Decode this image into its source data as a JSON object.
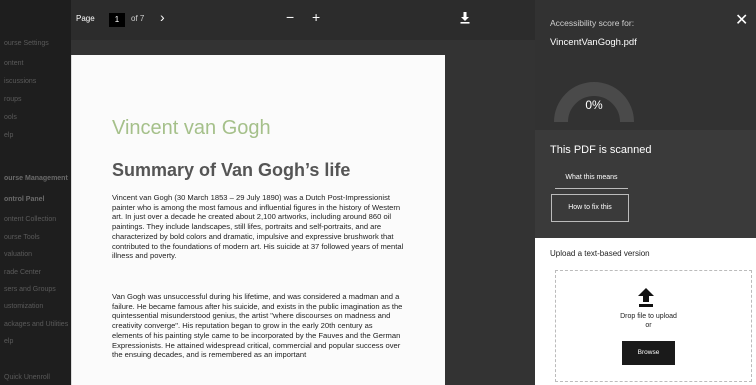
{
  "sidebar": {
    "items": [
      {
        "label": "ourse Settings",
        "head": false
      },
      {
        "label": "ontent",
        "head": false
      },
      {
        "label": "iscussions",
        "head": false
      },
      {
        "label": "roups",
        "head": false
      },
      {
        "label": "ools",
        "head": false
      },
      {
        "label": "elp",
        "head": false
      },
      {
        "label": "ourse Management",
        "head": true
      },
      {
        "label": "ontrol Panel",
        "head": true
      },
      {
        "label": "ontent Collection",
        "head": false
      },
      {
        "label": "ourse Tools",
        "head": false
      },
      {
        "label": "valuation",
        "head": false
      },
      {
        "label": "rade Center",
        "head": false
      },
      {
        "label": "sers and Groups",
        "head": false
      },
      {
        "label": "ustomization",
        "head": false
      },
      {
        "label": "ackages and Utilities",
        "head": false
      },
      {
        "label": "elp",
        "head": false
      },
      {
        "label": "Quick Unenroll",
        "head": false
      }
    ]
  },
  "toolbar": {
    "prev_icon": "‹",
    "next_icon": "›",
    "page_label": "Page",
    "page_value": "1",
    "page_of": "of 7",
    "zoom_out": "−",
    "zoom_in": "+",
    "download_icon": "download-icon"
  },
  "document": {
    "title": "Vincent van Gogh",
    "heading": "Summary of Van Gogh’s life",
    "paragraphs": [
      "Vincent van Gogh (30 March 1853 – 29 July 1890) was a Dutch Post-Impressionist painter who is among the most famous and influential figures in the history of Western art. In just over a decade he created about 2,100 artworks, including around 860 oil paintings. They include landscapes, still lifes, portraits and self-portraits, and are characterized by bold colors and dramatic, impulsive and expressive brushwork that contributed to the foundations of modern art. His suicide at 37 followed years of mental illness and poverty.",
      "Van Gogh was unsuccessful during his lifetime, and was considered a madman and a failure. He became famous after his suicide, and exists in the public imagination as the quintessential misunderstood genius, the artist \"where discourses on madness and creativity converge\". His reputation began to grow in the early 20th century as elements of his painting style came to be incorporated by the Fauves and the German Expressionists. He attained widespread critical, commercial and popular success over the ensuing decades, and is remembered as an important"
    ]
  },
  "panel": {
    "score_label": "Accessibility score for:",
    "filename": "VincentVanGogh.pdf",
    "close_icon": "✕",
    "score_percent": "0%",
    "score_value": 0,
    "scan_message": "This PDF is scanned",
    "what_button": "What this means",
    "fix_button": "How to fix this",
    "upload_title": "Upload a text-based version",
    "drop_text": "Drop file to upload",
    "drop_or": "or",
    "browse_button": "Browse"
  },
  "colors": {
    "title_green": "#a5c08a",
    "panel_bg": "#323232",
    "gauge_track": "#4a4a4a"
  }
}
